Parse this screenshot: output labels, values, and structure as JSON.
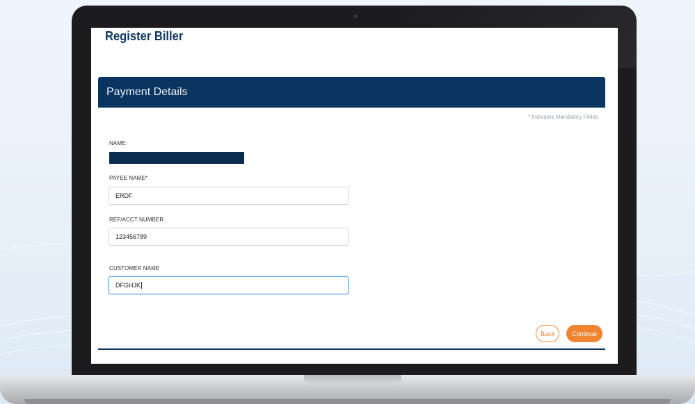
{
  "page": {
    "title": "Register Biller"
  },
  "panel": {
    "title": "Payment Details",
    "mandatory_note": "* Indicates Mandatory Fields"
  },
  "form": {
    "name_label": "NAME:",
    "payee_name_label": "PAYEE NAME*",
    "payee_name_value": "ERDF",
    "ref_acct_label": "REF/ACCT NUMBER",
    "ref_acct_value": "123456789",
    "customer_name_label": "CUSTOMER NAME",
    "customer_name_value": "DFGHJK"
  },
  "actions": {
    "back_label": "Back",
    "continue_label": "Continue"
  },
  "colors": {
    "header_navy": "#0b3561",
    "accent_orange": "#ef8532"
  }
}
